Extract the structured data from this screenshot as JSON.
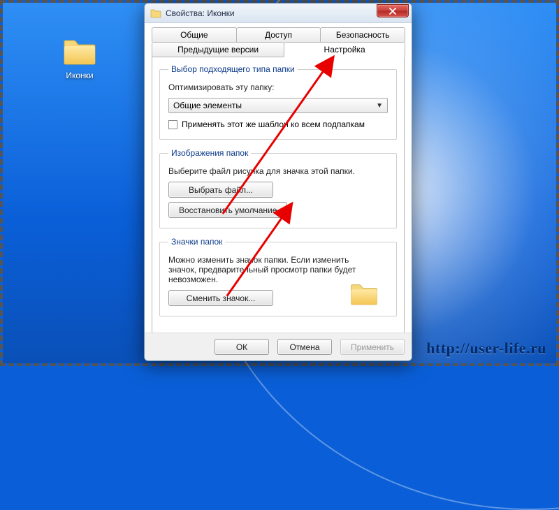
{
  "watermark": "http://user-life.ru",
  "desktop_icon": {
    "label": "Иконки"
  },
  "window": {
    "title": "Свойства: Иконки"
  },
  "tabs": {
    "row1": [
      "Общие",
      "Доступ",
      "Безопасность"
    ],
    "row2": [
      "Предыдущие версии",
      "Настройка"
    ],
    "active": "Настройка"
  },
  "group_type": {
    "legend": "Выбор подходящего типа папки",
    "optimize_label": "Оптимизировать эту папку:",
    "dropdown_value": "Общие элементы",
    "apply_sub_label": "Применять этот же шаблон ко всем подпапкам"
  },
  "group_images": {
    "legend": "Изображения папок",
    "subtext": "Выберите файл рисунка для значка этой папки.",
    "choose_file_btn": "Выбрать файл...",
    "restore_default_btn": "Восстановить умолчание"
  },
  "group_icons": {
    "legend": "Значки папок",
    "subtext": "Можно изменить значок папки. Если изменить значок, предварительный просмотр папки будет невозможен.",
    "change_icon_btn": "Сменить значок..."
  },
  "dialog_buttons": {
    "ok": "ОК",
    "cancel": "Отмена",
    "apply": "Применить"
  }
}
